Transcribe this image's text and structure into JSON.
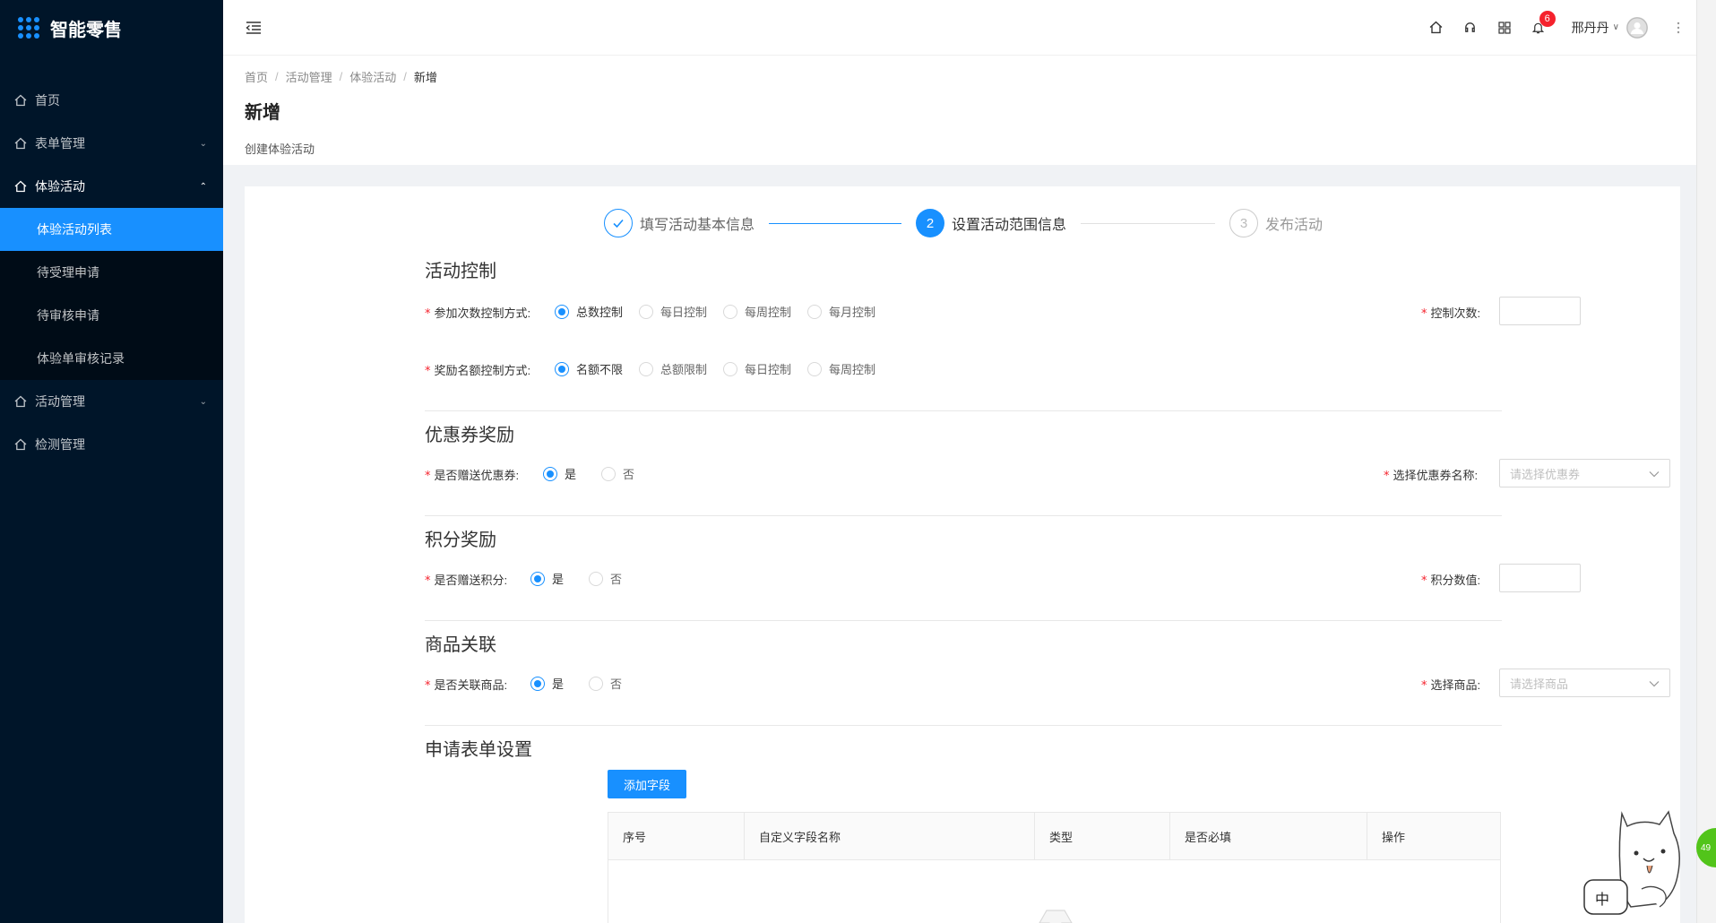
{
  "app": {
    "title": "智能零售"
  },
  "sidebar": {
    "items": [
      {
        "label": "首页",
        "icon": "home-icon"
      },
      {
        "label": "表单管理",
        "icon": "home-icon",
        "arrow": "down"
      },
      {
        "label": "体验活动",
        "icon": "home-icon",
        "arrow": "up"
      },
      {
        "label": "活动管理",
        "icon": "home-icon",
        "arrow": "down"
      },
      {
        "label": "检测管理",
        "icon": "home-icon"
      }
    ],
    "sub_items": [
      {
        "label": "体验活动列表",
        "active": true
      },
      {
        "label": "待受理申请"
      },
      {
        "label": "待审核申请"
      },
      {
        "label": "体验单审核记录"
      }
    ]
  },
  "header": {
    "notification_count": "6",
    "user_name": "邢丹丹",
    "user_caret": "∨"
  },
  "breadcrumb": [
    "首页",
    "活动管理",
    "体验活动",
    "新增"
  ],
  "page": {
    "title": "新增",
    "description": "创建体验活动"
  },
  "steps": [
    {
      "index": "1",
      "title": "填写活动基本信息",
      "status": "done"
    },
    {
      "index": "2",
      "title": "设置活动范围信息",
      "status": "current"
    },
    {
      "index": "3",
      "title": "发布活动",
      "status": "wait"
    }
  ],
  "sections": {
    "activity_control": {
      "title": "活动控制",
      "participation": {
        "label": "参加次数控制方式:",
        "options": [
          "总数控制",
          "每日控制",
          "每周控制",
          "每月控制"
        ],
        "selected": 0
      },
      "control_count": {
        "label": "控制次数:",
        "value": ""
      },
      "reward": {
        "label": "奖励名额控制方式:",
        "options": [
          "名额不限",
          "总额限制",
          "每日控制",
          "每周控制"
        ],
        "selected": 0
      }
    },
    "coupon": {
      "title": "优惠券奖励",
      "give": {
        "label": "是否赠送优惠券:",
        "options": [
          "是",
          "否"
        ],
        "selected": 0
      },
      "select": {
        "label": "选择优惠券名称:",
        "placeholder": "请选择优惠券"
      }
    },
    "points": {
      "title": "积分奖励",
      "give": {
        "label": "是否赠送积分:",
        "options": [
          "是",
          "否"
        ],
        "selected": 0
      },
      "value": {
        "label": "积分数值:",
        "value": ""
      }
    },
    "goods": {
      "title": "商品关联",
      "link": {
        "label": "是否关联商品:",
        "options": [
          "是",
          "否"
        ],
        "selected": 0
      },
      "select": {
        "label": "选择商品:",
        "placeholder": "请选择商品"
      }
    },
    "form_settings": {
      "title": "申请表单设置",
      "add_button": "添加字段",
      "columns": [
        "序号",
        "自定义字段名称",
        "类型",
        "是否必填",
        "操作"
      ]
    }
  },
  "widget": {
    "text": "中",
    "edge_badge": "49"
  },
  "colors": {
    "primary": "#1890ff",
    "sidebar_bg": "#001529",
    "required": "#f5222d"
  }
}
